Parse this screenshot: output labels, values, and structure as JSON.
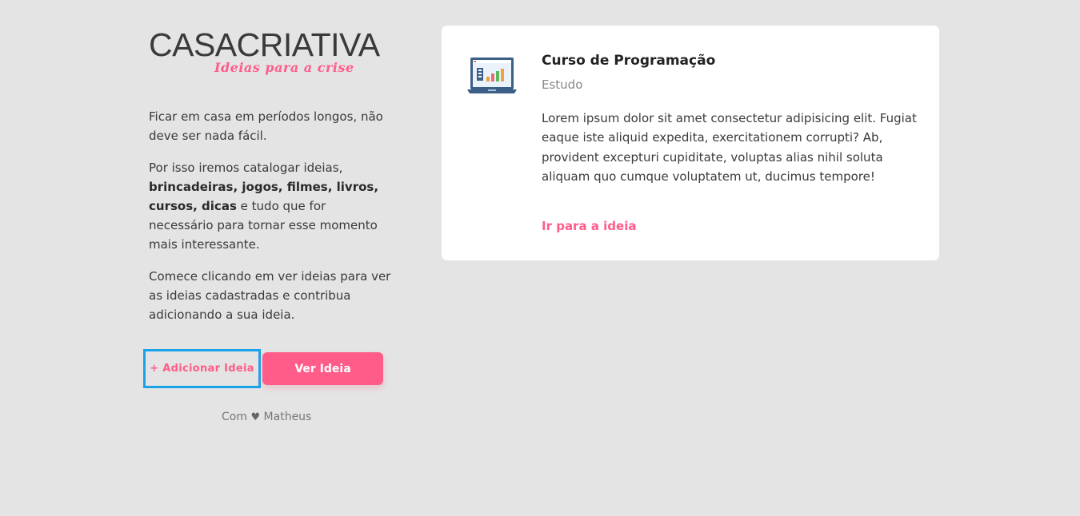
{
  "logo": {
    "casa": "CASA",
    "criativa": "CRIATIVA",
    "tagline": "Ideias para a crise"
  },
  "intro": {
    "p1": "Ficar em casa em períodos longos, não deve ser nada fácil.",
    "p2_before": "Por isso iremos catalogar ideias,",
    "p2_bold": "brincadeiras, jogos, filmes, livros, cursos, dicas",
    "p2_after": "e tudo que for necessário para tornar esse momento mais interessante.",
    "p3": "Comece clicando em ver ideias para ver as ideias cadastradas e contribua adicionando a sua ideia."
  },
  "buttons": {
    "add_label": "+ Adicionar Ideia",
    "view_label": "Ver Ideia"
  },
  "footer": {
    "prefix": "Com",
    "heart_icon": "heart-icon",
    "author": "Matheus"
  },
  "idea": {
    "icon": "laptop-chart-icon",
    "title": "Curso de Programação",
    "category": "Estudo",
    "description": "Lorem ipsum dolor sit amet consectetur adipisicing elit. Fugiat eaque iste aliquid expedita, exercitationem corrupti? Ab, provident excepturi cupiditate, voluptas alias nihil soluta aliquam quo cumque voluptatem ut, ducimus tempore!",
    "link_label": "Ir para a ideia"
  },
  "colors": {
    "accent": "#ff5c8a",
    "background": "#e4e4e4",
    "focus_outline": "#1aa3e8"
  }
}
